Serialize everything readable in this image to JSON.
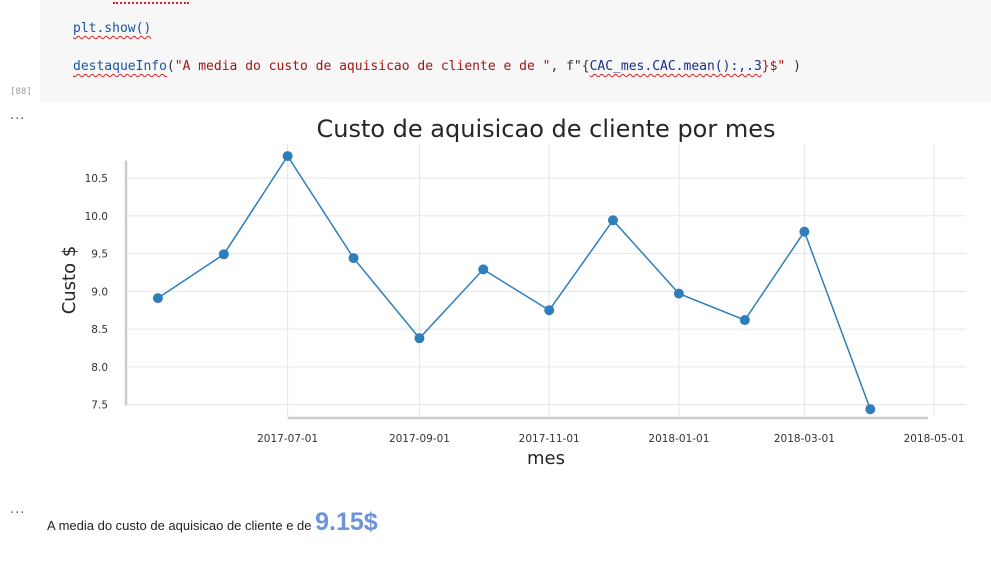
{
  "code": {
    "line1": "plt.show()",
    "line2": {
      "fn": "destaqueInfo",
      "open": "(",
      "str1": "\"A media do custo de aquisicao de cliente e de \"",
      "sep": ", f\"{",
      "expr": "CAC_mes.CAC.mean():,.3",
      "close_str": "}$\"",
      "close": " )"
    },
    "exec_count": "[88]"
  },
  "ellipsis": "...",
  "chart_data": {
    "type": "line",
    "title": "Custo de aquisicao de cliente por mes",
    "xlabel": "mes",
    "ylabel": "Custo $",
    "x": [
      "2017-05-01",
      "2017-06-01",
      "2017-07-01",
      "2017-08-01",
      "2017-09-01",
      "2017-10-01",
      "2017-11-01",
      "2017-12-01",
      "2018-01-01",
      "2018-02-01",
      "2018-03-01",
      "2018-04-01",
      "2018-05-01"
    ],
    "xticks": [
      "2017-07-01",
      "2017-09-01",
      "2017-11-01",
      "2018-01-01",
      "2018-03-01",
      "2018-05-01"
    ],
    "yticks": [
      "7.5",
      "8.0",
      "8.5",
      "9.0",
      "9.5",
      "10.0",
      "10.5"
    ],
    "ylim": [
      7.35,
      10.95
    ],
    "series": [
      {
        "values": [
          8.91,
          9.49,
          10.79,
          9.44,
          8.38,
          9.29,
          8.75,
          9.94,
          8.97,
          8.62,
          9.79,
          7.44
        ],
        "color": "#2f7ebc"
      }
    ],
    "grid": true
  },
  "output": {
    "prefix": "A media do custo de aquisicao de cliente e de ",
    "value": "9.15$"
  }
}
